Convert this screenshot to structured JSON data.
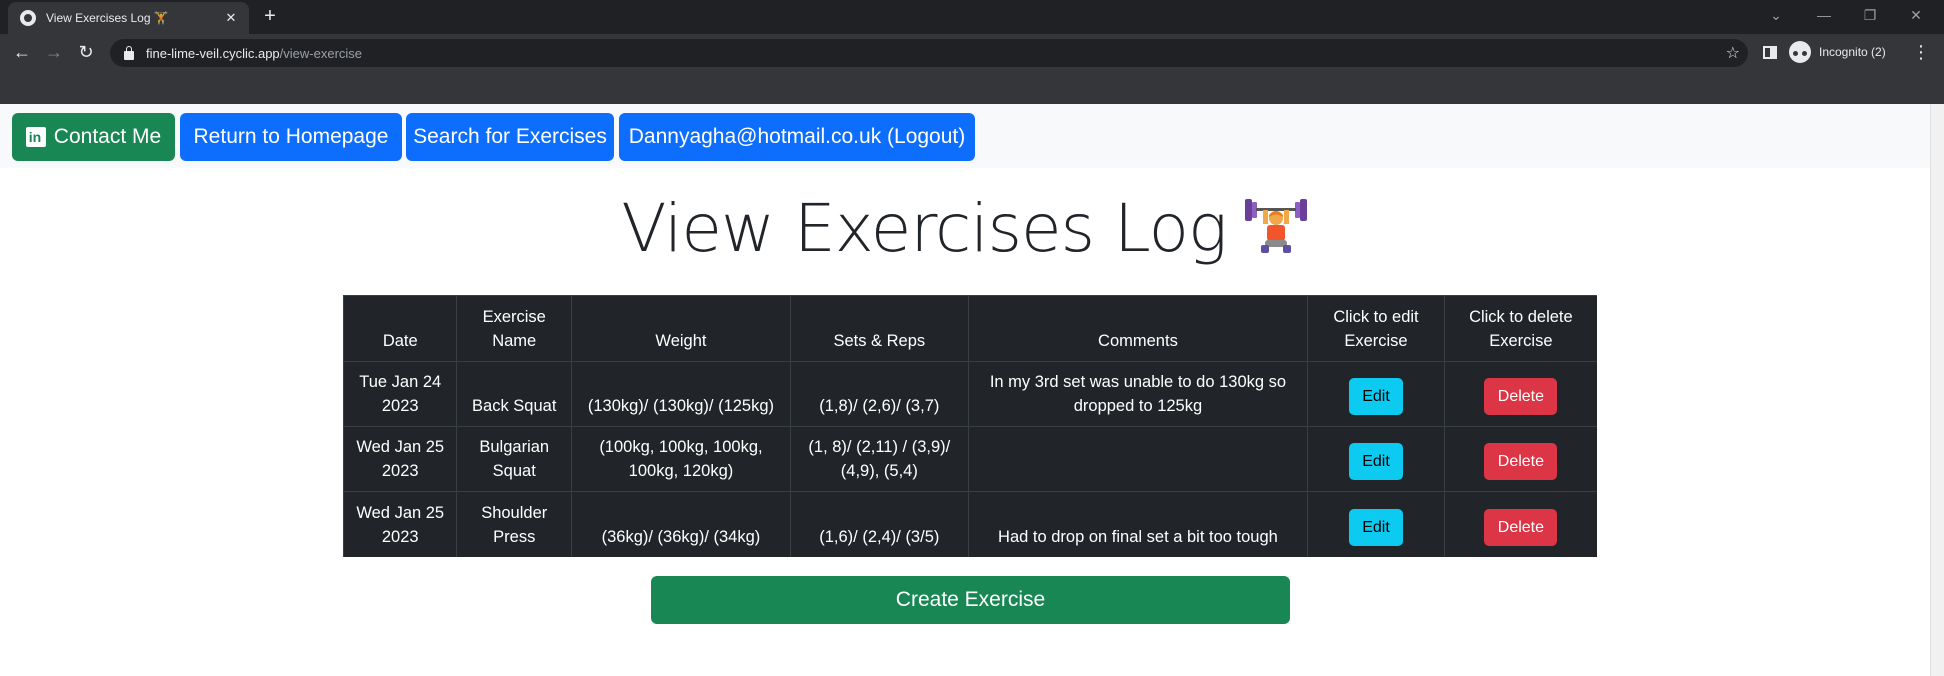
{
  "browser": {
    "tab_title": "View Exercises Log 🏋",
    "url_host": "fine-lime-veil.cyclic.app",
    "url_path": "/view-exercise",
    "incognito_label": "Incognito (2)"
  },
  "nav": {
    "contact": "Contact Me",
    "linkedin_glyph": "in",
    "home": "Return to Homepage",
    "search": "Search for Exercises",
    "account": "Dannyagha@hotmail.co.uk (Logout)"
  },
  "page": {
    "title": "View Exercises Log"
  },
  "table": {
    "headers": {
      "date": "Date",
      "name": "Exercise Name",
      "weight": "Weight",
      "sets": "Sets & Reps",
      "comments": "Comments",
      "edit": "Click to edit Exercise",
      "delete": "Click to delete Exercise"
    },
    "rows": [
      {
        "date": "Tue Jan 24 2023",
        "name": "Back Squat",
        "weight": "(130kg)/ (130kg)/ (125kg)",
        "sets": "(1,8)/ (2,6)/ (3,7)",
        "comments": "In my 3rd set was unable to do 130kg so dropped to 125kg",
        "edit": "Edit",
        "delete": "Delete"
      },
      {
        "date": "Wed Jan 25 2023",
        "name": "Bulgarian Squat",
        "weight": "(100kg, 100kg, 100kg, 100kg, 120kg)",
        "sets": "(1, 8)/ (2,11) / (3,9)/ (4,9), (5,4)",
        "comments": "",
        "edit": "Edit",
        "delete": "Delete"
      },
      {
        "date": "Wed Jan 25 2023",
        "name": "Shoulder Press",
        "weight": "(36kg)/ (36kg)/ (34kg)",
        "sets": "(1,6)/ (2,4)/ (3/5)",
        "comments": "Had to drop on final set a bit too tough",
        "edit": "Edit",
        "delete": "Delete"
      }
    ]
  },
  "create_button": "Create Exercise",
  "colors": {
    "primary": "#0d6efd",
    "success": "#198754",
    "info": "#0dcaf0",
    "danger": "#dc3545",
    "table_dark": "#212529"
  }
}
